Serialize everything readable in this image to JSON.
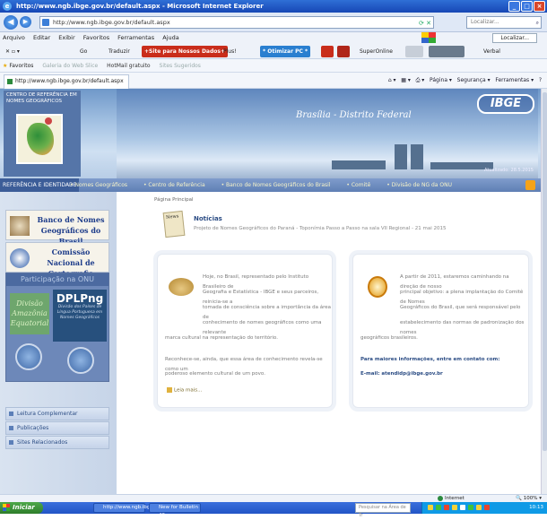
{
  "window": {
    "title": "http://www.ngb.ibge.gov.br/default.aspx - Microsoft Internet Explorer"
  },
  "address": {
    "url": "http://www.ngb.ibge.gov.br/default.aspx",
    "search_placeholder": "Localizar..."
  },
  "menu": {
    "items": [
      "Arquivo",
      "Editar",
      "Exibir",
      "Favoritos",
      "Ferramentas",
      "Ajuda"
    ],
    "locator_label": "Localizar..."
  },
  "toolbar": {
    "go_label": "Go",
    "translate_label": "Traduzir",
    "site_label": "+Site para Nossos Dados+",
    "plus_label": "Plus!",
    "optimize_label": "* Otimizar PC *",
    "superonline_label": "SuperOnline",
    "verbal_label": "Verbal"
  },
  "favorites": {
    "label": "Favoritos",
    "items": [
      {
        "label": "Galeria do Web Slice",
        "faded": true
      },
      {
        "label": "HotMail gratuito",
        "faded": false
      },
      {
        "label": "Sites Sugeridos",
        "faded": true
      }
    ]
  },
  "tab": {
    "title": "http://www.ngb.ibge.gov.br/default.aspx"
  },
  "command_bar": {
    "items": [
      "Página",
      "Segurança",
      "Ferramentas"
    ]
  },
  "banner": {
    "center_title": "CENTRO DE REFERÊNCIA EM NOMES GEOGRÁFICOS",
    "city": "Brasília - Distrito Federal",
    "brand": "IBGE",
    "update_text": "Atualizado: 28.5.2015"
  },
  "nav": {
    "first": "REFERÊNCIA E IDENTIDADE",
    "items": [
      "Nomes Geográficos",
      "Centro de Referência",
      "Banco de Nomes Geográficos do Brasil",
      "Comitê",
      "Divisão de NG da ONU"
    ]
  },
  "left": {
    "boxes": [
      {
        "label": "Banco de Nomes Geográficos do Brasil"
      },
      {
        "label": "Comissão Nacional de Cartografia"
      }
    ],
    "onu_header": "Participação na ONU",
    "onu_group": "Divisão Amazônia Equatorial",
    "dplpng_title": "DPLPng",
    "dplpng_sub": "Divisão dos Países de Língua Portuguesa em Nomes Geográficos",
    "links": [
      "Leitura Complementar",
      "Publicações",
      "Sites Relacionados"
    ]
  },
  "main": {
    "breadcrumb": "Página Principal",
    "news_title": "Notícias",
    "news_line": "Projeto de Nomes Geográficos do Paraná - Toponímia Passo a Passo na sala VII Regional - 21 mai 2015",
    "card1": {
      "p1": "Hoje, no Brasil, representado pelo Instituto Brasileiro de",
      "p2": "Geografia e Estatística - IBGE e seus parceiros, reinicia-se a",
      "p3": "tomada de consciência sobre a importância da área de",
      "p4": "conhecimento de nomes geográficos como uma relevante",
      "p5": "marca cultural na representação do território.",
      "p6": "Reconhece-se, ainda, que essa área de conhecimento revela-se como um",
      "p7": "poderoso elemento cultural de um povo.",
      "more": "Leia mais..."
    },
    "card2": {
      "p1": "A partir de 2011, estaremos caminhando na direção de nosso",
      "p2": "principal objetivo: a plena implantação do Comitê de Nomes",
      "p3": "Geográficos do Brasil, que será responsável pelo",
      "p4": "estabelecimento das normas de padronização dos nomes",
      "p5": "geográficos brasileiros.",
      "contact": "Para maiores informações, entre em contato com:",
      "email": "E-mail: atendidp@ibge.gov.br"
    }
  },
  "status": {
    "zone": "Internet",
    "zoom": "100%"
  },
  "taskbar": {
    "start": "Iniciar",
    "tasks": [
      "http://www.ngb.ibge...",
      "New for Bulletin 40..."
    ],
    "search_placeholder": "Pesquisar na Área de Tr",
    "clock": "10:13"
  }
}
